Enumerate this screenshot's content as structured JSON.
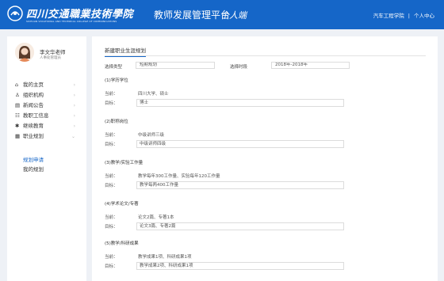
{
  "header": {
    "brand_cn": "四川交通職業技術學院",
    "brand_en": "SICHUAN VOCATIONAL AND TECHNICAL COLLEGE OF COMMUNICATIONS",
    "platform_title": "教师发展管理平台",
    "platform_sub": "个人端",
    "college": "汽车工程学院",
    "separator": "|",
    "personal_center": "个人中心",
    "brand_color": "#1566c8"
  },
  "user": {
    "name": "李文华老师",
    "role": "人事处管理员"
  },
  "menu": [
    {
      "label": "我的主页",
      "icon": "home-icon",
      "glyph": "⌂"
    },
    {
      "label": "组织机构",
      "icon": "org-icon",
      "glyph": "♙"
    },
    {
      "label": "新闻公告",
      "icon": "news-icon",
      "glyph": "▤"
    },
    {
      "label": "教职工信息",
      "icon": "staff-icon",
      "glyph": "☷"
    },
    {
      "label": "继续教育",
      "icon": "education-icon",
      "glyph": "✱"
    },
    {
      "label": "职业规划",
      "icon": "calendar-icon",
      "glyph": "▦"
    }
  ],
  "submenu": [
    {
      "label": "规划申请",
      "active": true
    },
    {
      "label": "我的规划",
      "active": false
    }
  ],
  "main": {
    "title": "新建职业生涯规划",
    "type_label": "选择类型",
    "type_value": "短期规划",
    "period_label": "选择时段",
    "period_value": "2018年-2018年",
    "current_label": "当前：",
    "goal_label": "目标：",
    "sections": [
      {
        "title": "(1)学历学位",
        "current": "四川大学、硕士",
        "goal": "博士"
      },
      {
        "title": "(2)职称岗位",
        "current": "中级讲师三级",
        "goal": "中级讲师四级"
      },
      {
        "title": "(3)教学/实验工作量",
        "current": "教学每年300工作量、实验每年120工作量",
        "goal": "教学每两400工作量"
      },
      {
        "title": "(4)学术论文/专著",
        "current": "论文2篇、专著1本",
        "goal": "论文3篇、专著2篇"
      },
      {
        "title": "(5)教学/科研成果",
        "current": "教学成果1项、科研成果1项",
        "goal": "教学成果2项、科研成果1项"
      }
    ]
  }
}
